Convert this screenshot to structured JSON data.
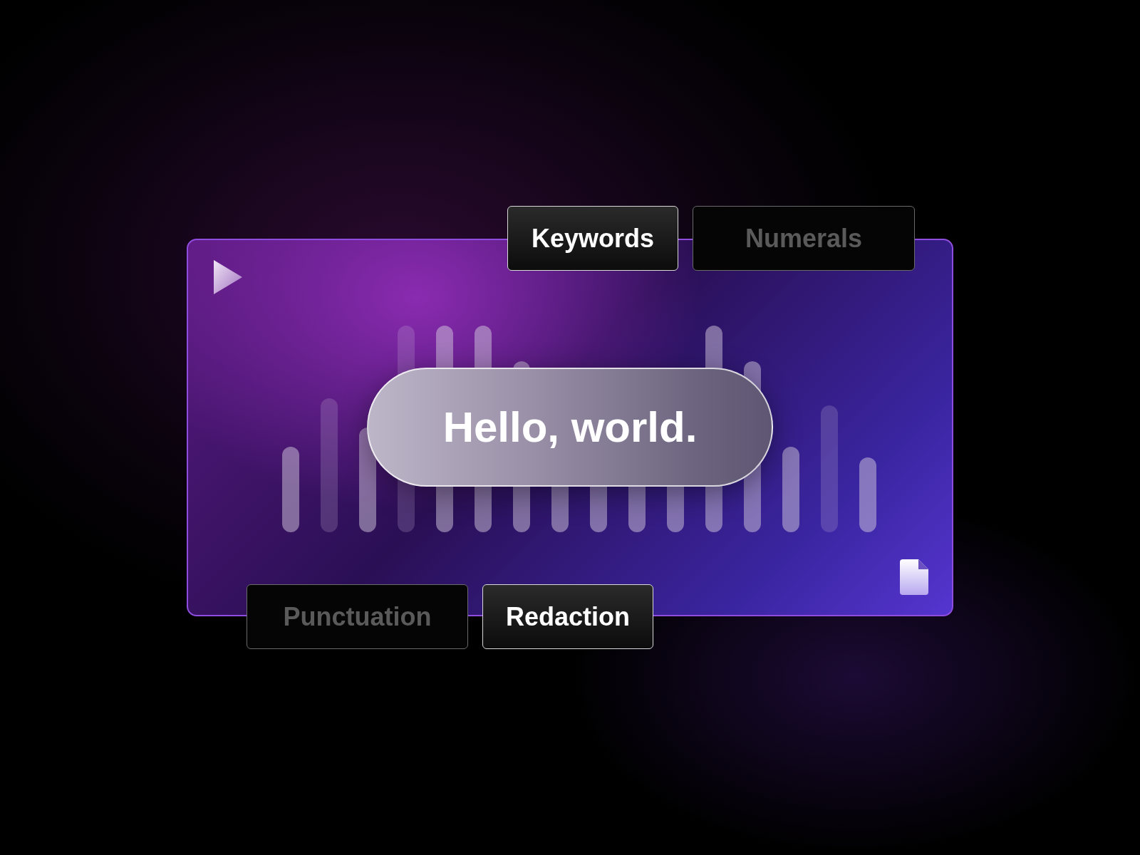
{
  "caption": "Hello, world.",
  "tags": [
    {
      "label": "Keywords",
      "selected": true
    },
    {
      "label": "Numerals",
      "selected": false
    },
    {
      "label": "Punctuation",
      "selected": false
    },
    {
      "label": "Redaction",
      "selected": true
    }
  ]
}
